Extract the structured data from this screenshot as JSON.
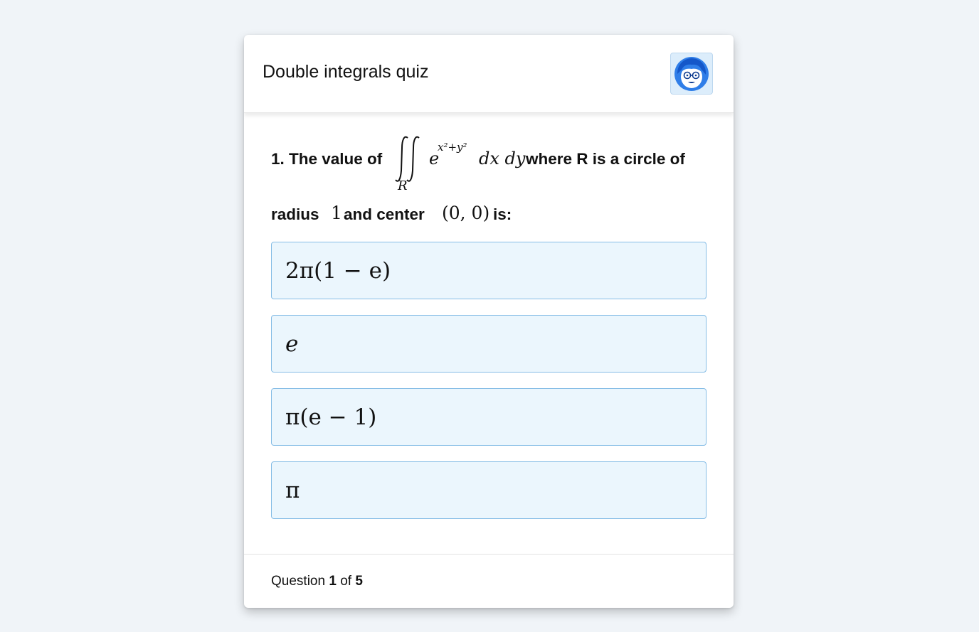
{
  "header": {
    "title": "Double integrals quiz",
    "avatar": "avatar-icon"
  },
  "question": {
    "prefix": "1. The value of",
    "integral_region": "R",
    "integrand": "e",
    "exponent": "x²+y²",
    "differentials": "dx dy",
    "middle": "where R is a circle of",
    "line2_a": "radius",
    "radius_value": "1",
    "line2_b": "and center",
    "center_value": "(0, 0)",
    "line2_c": "is:"
  },
  "options": [
    {
      "text": "2π(1 − e)"
    },
    {
      "text": "e"
    },
    {
      "text": "π(e − 1)"
    },
    {
      "text": "π"
    }
  ],
  "footer": {
    "label": "Question",
    "current": "1",
    "of_label": "of",
    "total": "5"
  },
  "colors": {
    "page_background": "#f0f4f8",
    "option_background": "#ebf6fd",
    "option_border": "#86bde6",
    "avatar_background": "#dcedfb"
  }
}
